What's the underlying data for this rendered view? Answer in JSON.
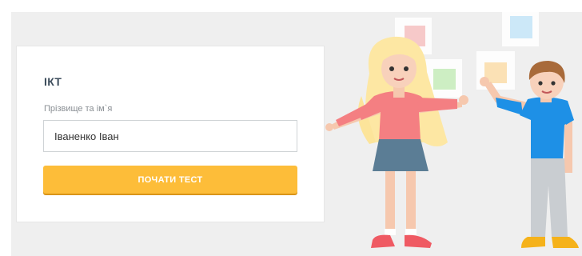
{
  "form": {
    "title": "ІКТ",
    "name_label": "Прізвище та ім`я",
    "name_value": "Іваненко Іван",
    "start_button_label": "ПОЧАТИ ТЕСТ"
  },
  "colors": {
    "background": "#efefef",
    "card": "#ffffff",
    "accent_button": "#fdbd39",
    "title_text": "#3d4d5c"
  },
  "illustration": {
    "icons": [
      "girl-figure-icon",
      "boy-figure-icon",
      "floating-squares-icon"
    ]
  }
}
